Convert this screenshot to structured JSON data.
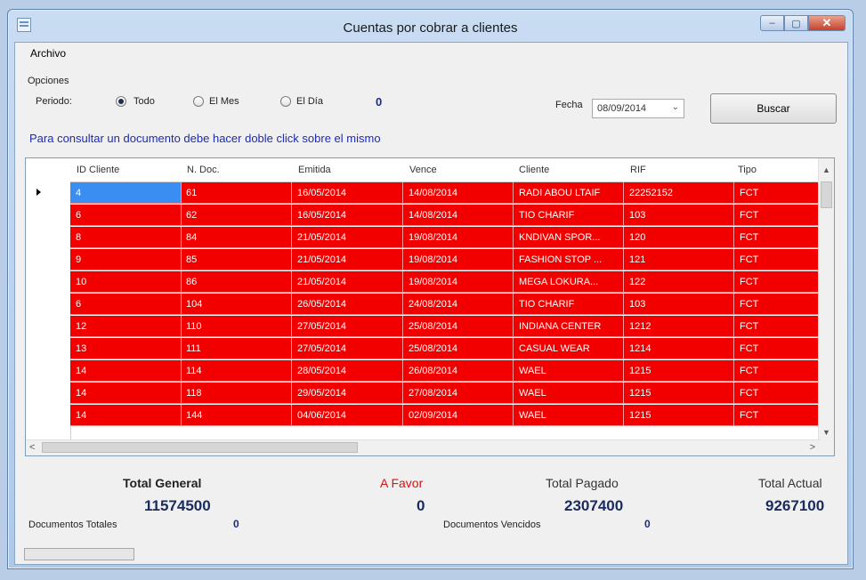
{
  "window": {
    "title": "Cuentas por cobrar a clientes",
    "buttons": {
      "minimize": "‒",
      "maximize": "▢",
      "close": "✕"
    }
  },
  "menu": {
    "archivo": "Archivo"
  },
  "options": {
    "group_label": "Opciones",
    "periodo_label": "Periodo:",
    "radios": [
      {
        "label": "Todo",
        "checked": true
      },
      {
        "label": "El Mes",
        "checked": false
      },
      {
        "label": "El Día",
        "checked": false
      }
    ],
    "count": "0",
    "fecha_label": "Fecha",
    "fecha_value": "08/09/2014",
    "buscar_label": "Buscar",
    "instruction": "Para consultar un documento debe hacer doble click sobre el mismo"
  },
  "grid": {
    "columns": [
      "ID Cliente",
      "N. Doc.",
      "Emitida",
      "Vence",
      "Cliente",
      "RIF",
      "Tipo"
    ],
    "row_color": "#f20000",
    "rows": [
      [
        "4",
        "61",
        "16/05/2014",
        "14/08/2014",
        "RADI ABOU LTAIF",
        "22252152",
        "FCT"
      ],
      [
        "6",
        "62",
        "16/05/2014",
        "14/08/2014",
        "TIO CHARIF",
        "103",
        "FCT"
      ],
      [
        "8",
        "84",
        "21/05/2014",
        "19/08/2014",
        "KNDIVAN SPOR...",
        "120",
        "FCT"
      ],
      [
        "9",
        "85",
        "21/05/2014",
        "19/08/2014",
        "FASHION STOP ...",
        "121",
        "FCT"
      ],
      [
        "10",
        "86",
        "21/05/2014",
        "19/08/2014",
        "MEGA LOKURA...",
        "122",
        "FCT"
      ],
      [
        "6",
        "104",
        "26/05/2014",
        "24/08/2014",
        "TIO CHARIF",
        "103",
        "FCT"
      ],
      [
        "12",
        "110",
        "27/05/2014",
        "25/08/2014",
        "INDIANA CENTER",
        "1212",
        "FCT"
      ],
      [
        "13",
        "111",
        "27/05/2014",
        "25/08/2014",
        "CASUAL WEAR",
        "1214",
        "FCT"
      ],
      [
        "14",
        "114",
        "28/05/2014",
        "26/08/2014",
        "WAEL",
        "1215",
        "FCT"
      ],
      [
        "14",
        "118",
        "29/05/2014",
        "27/08/2014",
        "WAEL",
        "1215",
        "FCT"
      ],
      [
        "14",
        "144",
        "04/06/2014",
        "02/09/2014",
        "WAEL",
        "1215",
        "FCT"
      ]
    ],
    "selected_row": 0,
    "scroll": {
      "up": "▲",
      "down": "▼",
      "left": "<",
      "right": ">"
    }
  },
  "totals": {
    "general_label": "Total General",
    "general_value": "11574500",
    "favor_label": "A Favor",
    "favor_value": "0",
    "pagado_label": "Total Pagado",
    "pagado_value": "2307400",
    "actual_label": "Total Actual",
    "actual_value": "9267100",
    "docs_totales_label": "Documentos Totales",
    "docs_totales_value": "0",
    "docs_vencidos_label": "Documentos Vencidos",
    "docs_vencidos_value": "0"
  }
}
